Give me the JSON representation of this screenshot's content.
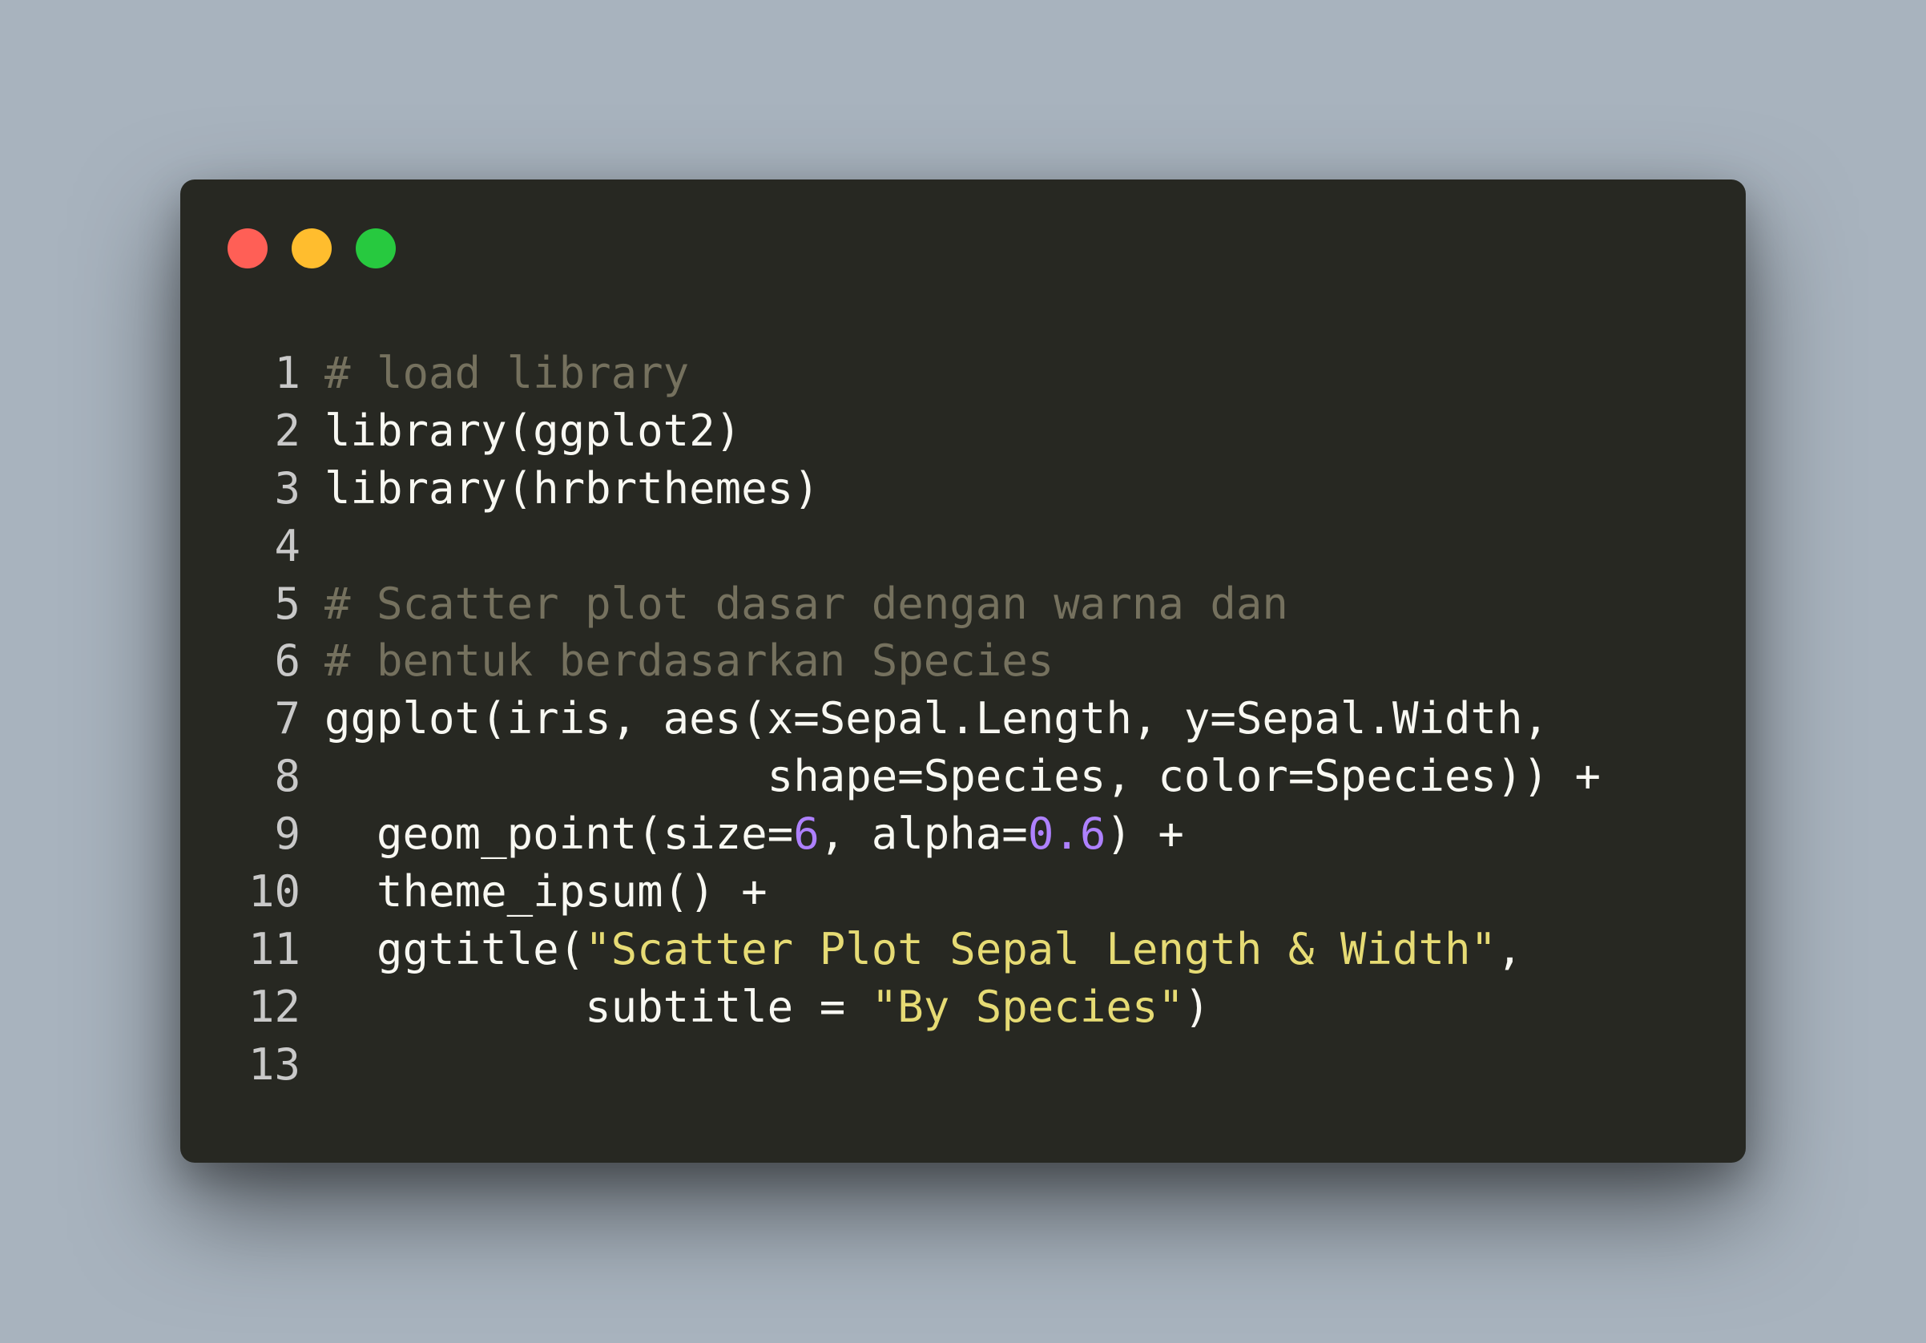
{
  "window": {
    "traffic_lights": [
      {
        "name": "close",
        "color": "#ff5f56"
      },
      {
        "name": "minimize",
        "color": "#ffbd2e"
      },
      {
        "name": "maximize",
        "color": "#27c93f"
      }
    ]
  },
  "code": {
    "language": "R",
    "lines": [
      {
        "number": "1",
        "tokens": [
          {
            "type": "comment",
            "text": "# load library"
          }
        ]
      },
      {
        "number": "2",
        "tokens": [
          {
            "type": "plain",
            "text": "library(ggplot2)"
          }
        ]
      },
      {
        "number": "3",
        "tokens": [
          {
            "type": "plain",
            "text": "library(hrbrthemes)"
          }
        ]
      },
      {
        "number": "4",
        "tokens": []
      },
      {
        "number": "5",
        "tokens": [
          {
            "type": "comment",
            "text": "# Scatter plot dasar dengan warna dan"
          }
        ]
      },
      {
        "number": "6",
        "tokens": [
          {
            "type": "comment",
            "text": "# bentuk berdasarkan Species"
          }
        ]
      },
      {
        "number": "7",
        "tokens": [
          {
            "type": "plain",
            "text": "ggplot(iris, aes(x=Sepal.Length, y=Sepal.Width,"
          }
        ]
      },
      {
        "number": "8",
        "tokens": [
          {
            "type": "plain",
            "text": "                 shape=Species, color=Species)) +"
          }
        ]
      },
      {
        "number": "9",
        "tokens": [
          {
            "type": "plain",
            "text": "  geom_point(size="
          },
          {
            "type": "number",
            "text": "6"
          },
          {
            "type": "plain",
            "text": ", alpha="
          },
          {
            "type": "number",
            "text": "0.6"
          },
          {
            "type": "plain",
            "text": ") +"
          }
        ]
      },
      {
        "number": "10",
        "tokens": [
          {
            "type": "plain",
            "text": "  theme_ipsum() +"
          }
        ]
      },
      {
        "number": "11",
        "tokens": [
          {
            "type": "plain",
            "text": "  ggtitle("
          },
          {
            "type": "string",
            "text": "\"Scatter Plot Sepal Length & Width\""
          },
          {
            "type": "plain",
            "text": ","
          }
        ]
      },
      {
        "number": "12",
        "tokens": [
          {
            "type": "plain",
            "text": "          subtitle = "
          },
          {
            "type": "string",
            "text": "\"By Species\""
          },
          {
            "type": "plain",
            "text": ")"
          }
        ]
      },
      {
        "number": "13",
        "tokens": []
      }
    ]
  }
}
